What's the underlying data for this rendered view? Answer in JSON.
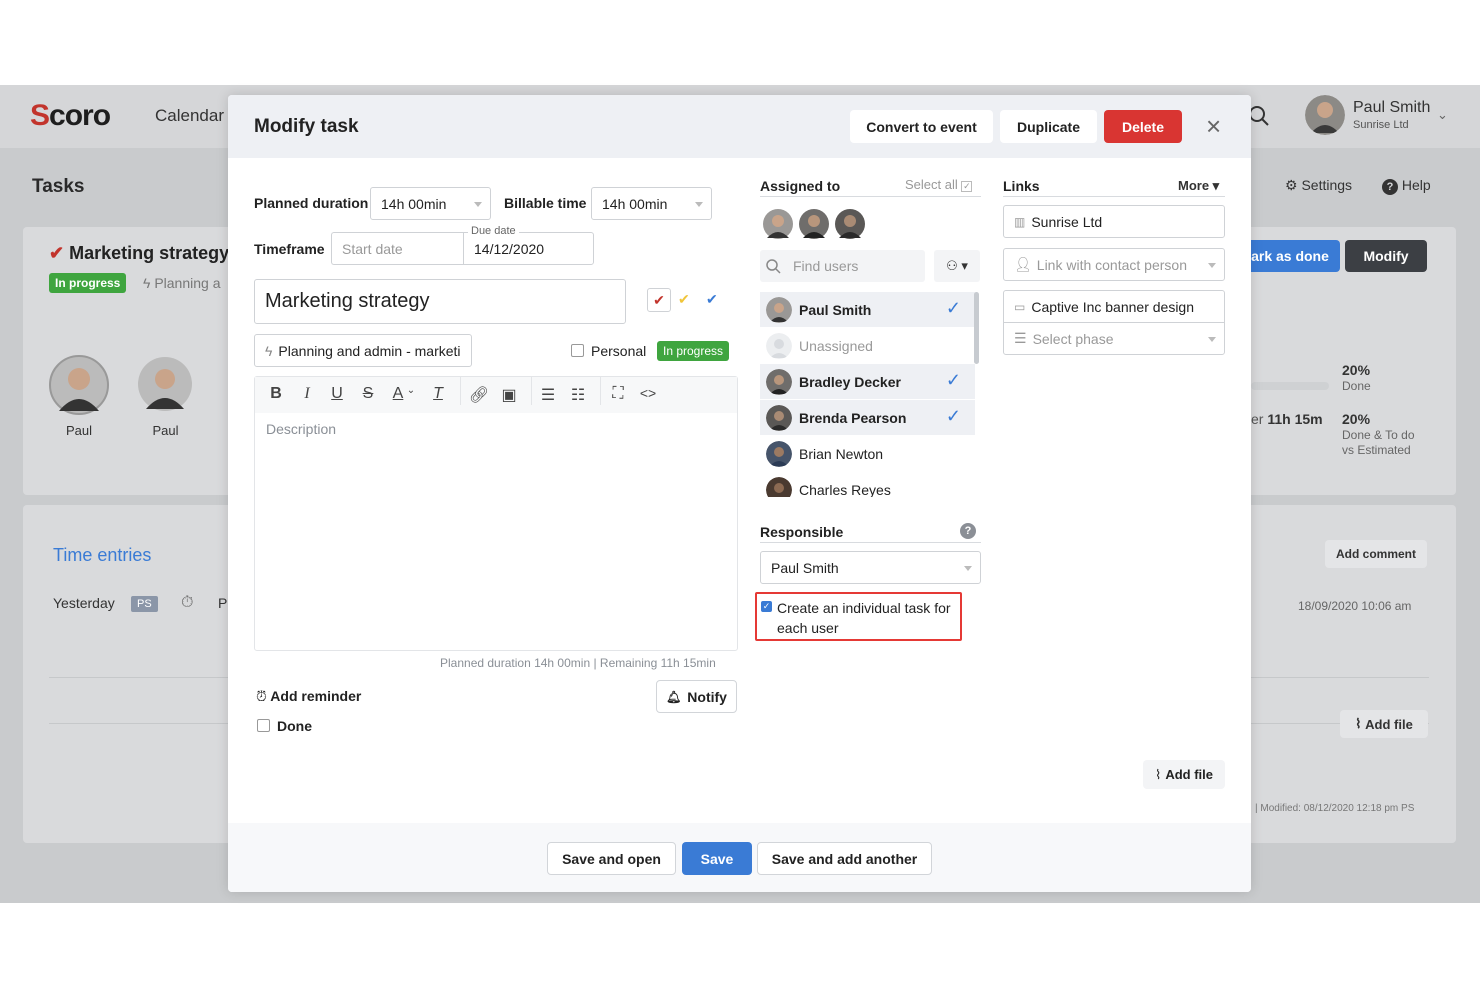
{
  "topbar": {
    "calendar": "Calendar",
    "user_name": "Paul Smith",
    "user_company": "Sunrise Ltd"
  },
  "background": {
    "page_title": "Tasks",
    "settings": "Settings",
    "help": "Help",
    "task_title": "Marketing strategy",
    "status": "In progress",
    "project": "Planning a",
    "mark_done": "ark as done",
    "modify": "Modify",
    "people": [
      "Paul",
      "Paul"
    ],
    "pct1": "20%",
    "pct1_label": "Done",
    "remaining_prefix": "er",
    "remaining_value": "11h 15m",
    "pct2": "20%",
    "pct2_label_1": "Done & To do",
    "pct2_label_2": "vs Estimated",
    "time_entries": "Time entries",
    "add_comment": "Add comment",
    "entry_day": "Yesterday",
    "entry_initials": "PS",
    "entry_p": "Pl",
    "entry_time": "18/09/2020 10:06 am",
    "add_file": "Add file",
    "modified": "| Modified: 08/12/2020 12:18 pm PS"
  },
  "modal": {
    "title": "Modify task",
    "convert": "Convert to event",
    "duplicate": "Duplicate",
    "delete": "Delete",
    "planned_label": "Planned duration",
    "planned_value": "14h 00min",
    "billable_label": "Billable time",
    "billable_value": "14h 00min",
    "timeframe_label": "Timeframe",
    "start_placeholder": "Start date",
    "due_label": "Due date",
    "due_value": "14/12/2020",
    "task_name": "Marketing strategy",
    "project_value": "Planning and admin - marketi",
    "personal": "Personal",
    "status": "In progress",
    "description_placeholder": "Description",
    "duration_note": "Planned duration 14h 00min | Remaining 11h 15min",
    "add_reminder": "Add reminder",
    "notify": "Notify",
    "done": "Done",
    "assigned_label": "Assigned to",
    "select_all": "Select all",
    "find_users": "Find users",
    "users": [
      {
        "name": "Paul Smith",
        "checked": true,
        "bold": true
      },
      {
        "name": "Unassigned",
        "checked": false,
        "bold": false
      },
      {
        "name": "Bradley Decker",
        "checked": true,
        "bold": true
      },
      {
        "name": "Brenda Pearson",
        "checked": true,
        "bold": true
      },
      {
        "name": "Brian Newton",
        "checked": false,
        "bold": false
      },
      {
        "name": "Charles Reyes",
        "checked": false,
        "bold": false
      }
    ],
    "responsible_label": "Responsible",
    "responsible_value": "Paul Smith",
    "individual_task": "Create an individual task for each user",
    "links_label": "Links",
    "more": "More",
    "link_company": "Sunrise Ltd",
    "link_contact_placeholder": "Link with contact person",
    "link_project": "Captive Inc banner design",
    "select_phase": "Select phase",
    "add_file": "Add file",
    "save_open": "Save and open",
    "save": "Save",
    "save_another": "Save and add another"
  },
  "colors": {
    "accent": "#3a7bd5",
    "danger": "#d93532",
    "green": "#3fa53f",
    "highlight": "#e53935"
  }
}
